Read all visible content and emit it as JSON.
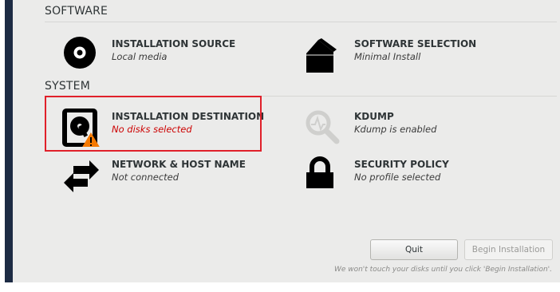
{
  "sections": {
    "software": "SOFTWARE",
    "system": "SYSTEM"
  },
  "spokes": {
    "installation_source": {
      "title": "INSTALLATION SOURCE",
      "status": "Local media",
      "icon": "disc-icon"
    },
    "software_selection": {
      "title": "SOFTWARE SELECTION",
      "status": "Minimal Install",
      "icon": "package-icon"
    },
    "installation_destination": {
      "title": "INSTALLATION DESTINATION",
      "status": "No disks selected",
      "icon": "harddisk-warning-icon"
    },
    "kdump": {
      "title": "KDUMP",
      "status": "Kdump is enabled",
      "icon": "magnifier-icon"
    },
    "network": {
      "title": "NETWORK & HOST NAME",
      "status": "Not connected",
      "icon": "network-arrows-icon"
    },
    "security_policy": {
      "title": "SECURITY POLICY",
      "status": "No profile selected",
      "icon": "padlock-icon"
    }
  },
  "buttons": {
    "quit": "Quit",
    "begin": "Begin Installation"
  },
  "hint": "We won't touch your disks until you click 'Begin Installation'.",
  "colors": {
    "warning_text": "#cc0000",
    "highlight_border": "#e0202a",
    "warning_triangle": "#f57900",
    "panel_bg": "#ebebea",
    "sidebar": "#1d2b44"
  }
}
